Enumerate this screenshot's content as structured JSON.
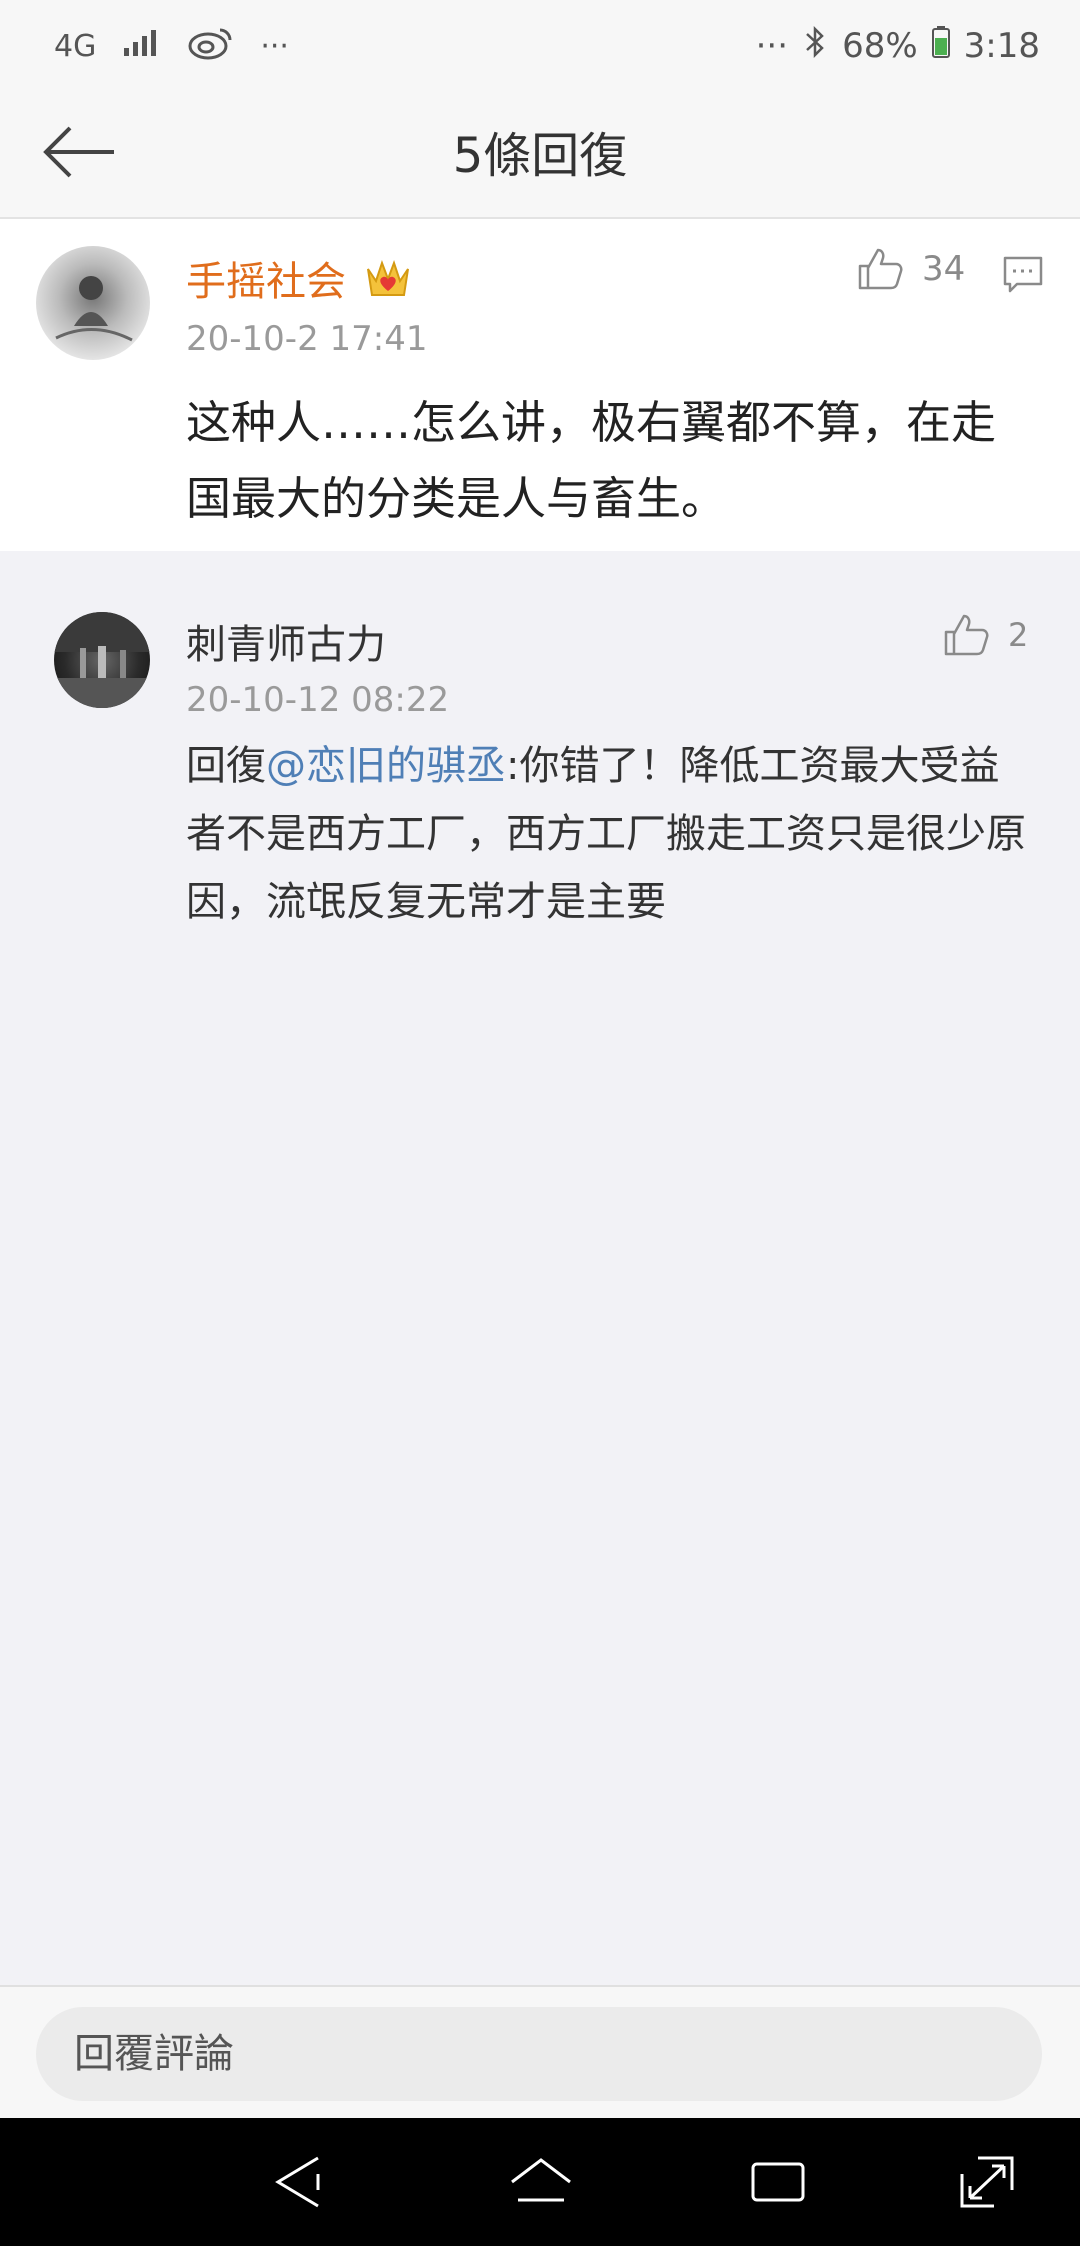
{
  "status_bar": {
    "network": "4G",
    "overflow_left": "···",
    "overflow_right": "···",
    "battery": "68%",
    "time": "3:18"
  },
  "header": {
    "title": "5條回復"
  },
  "comment_main": {
    "author": "手摇社会",
    "badge_icon": "crown-heart-icon",
    "timestamp": "20-10-2 17:41",
    "likes": "34",
    "text": "这种人……怎么讲，极右翼都不算，在走国最大的分类是人与畜生。"
  },
  "reply": {
    "author": "刺青师古力",
    "timestamp": "20-10-12 08:22",
    "likes": "2",
    "prefix": "回復",
    "mention": "@恋旧的骐丞",
    "text": ":你错了！降低工资最大受益者不是西方工厂，西方工厂搬走工资只是很少原因，流氓反复无常才是主要"
  },
  "input_bar": {
    "placeholder": "回覆評論"
  },
  "colors": {
    "author_vip": "#e06d1c",
    "mention": "#4f7fb6",
    "timestamp": "#9a9a9a"
  }
}
